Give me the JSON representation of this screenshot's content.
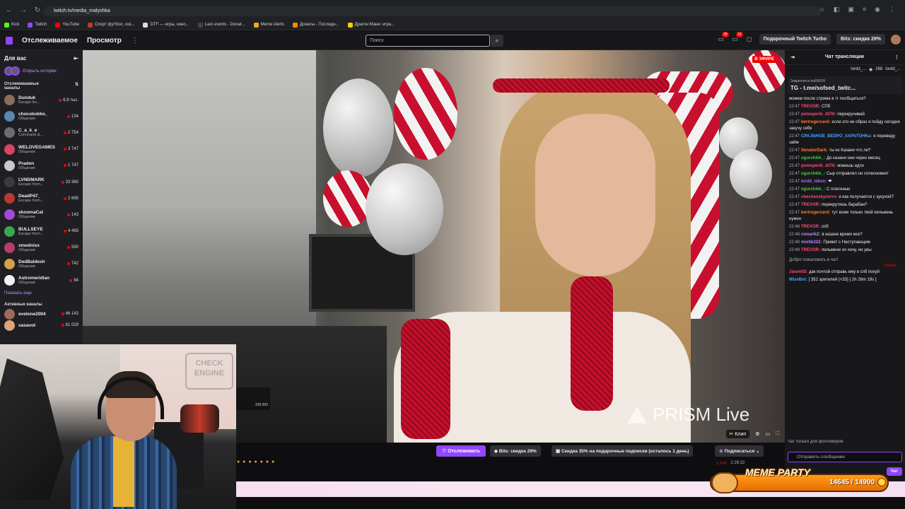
{
  "browser": {
    "url": "twitch.tv/media_malyshka",
    "bookmarks": [
      "Kick",
      "Twitch",
      "YouTube",
      "Спорт футбол, хок...",
      "DTF — игры, кино...",
      "Last events - Donat...",
      "Meme Alerts",
      "Донаты - Последн...",
      "Драгон Мани: игра..."
    ]
  },
  "header": {
    "nav_following": "Отслеживаемое",
    "nav_browse": "Просмотр",
    "search_placeholder": "Поиск",
    "notif_badge_1": "28",
    "notif_badge_2": "16",
    "turbo_label": "Подарочный Twitch Turbo",
    "bits_label": "Bits: скидка 29%"
  },
  "sidebar": {
    "title": "Для вас",
    "stories_label": "Открыть истории",
    "followed_title": "Отслеживаемые каналы",
    "channels": [
      {
        "name": "Dunduk",
        "category": "Escape fro...",
        "viewers": "6,9 тыс.",
        "color": "#8a6d5a"
      },
      {
        "name": "chocokokko_",
        "category": "Общение",
        "viewers": "134",
        "color": "#5b86b1"
      },
      {
        "name": "C_a_k_e",
        "category": "Command &...",
        "viewers": "2 754",
        "color": "#6c6c74"
      },
      {
        "name": "WELOVEGAMES",
        "category": "Общение",
        "viewers": "3 747",
        "color": "#d64561"
      },
      {
        "name": "Praden",
        "category": "Общение",
        "viewers": "1 747",
        "color": "#c9c9c9"
      },
      {
        "name": "LVNDMARK",
        "category": "Escape from...",
        "viewers": "33 360",
        "color": "#3b3b3b"
      },
      {
        "name": "DeadP47_",
        "category": "Escape from...",
        "viewers": "2 895",
        "color": "#b8392e"
      },
      {
        "name": "skoomaCat",
        "category": "Общение",
        "viewers": "143",
        "color": "#a04bd6"
      },
      {
        "name": "BULLSEYE",
        "category": "Escape from...",
        "viewers": "4 493",
        "color": "#3aa84c"
      },
      {
        "name": "xmednisx",
        "category": "Общение",
        "viewers": "590",
        "color": "#b33f66"
      },
      {
        "name": "DedBaldesh",
        "category": "Общение",
        "viewers": "742",
        "color": "#d6a04b"
      },
      {
        "name": "Astromeridian",
        "category": "Общение",
        "viewers": "94",
        "color": "#f2f2f2"
      }
    ],
    "show_more": "Показать еще",
    "active_title": "Активные каналы",
    "active_channels": [
      {
        "name": "evelone2004",
        "viewers": "46 143",
        "color": "#9d6b5a"
      },
      {
        "name": "sasavot",
        "viewers": "81 029",
        "color": "#e0a27b"
      }
    ]
  },
  "player": {
    "live_badge": "В ЭФИРЕ",
    "watermark": "PRISM Live",
    "clip_label": "Клип",
    "small_overlay": "339 000"
  },
  "info_bar": {
    "follow_label": "Отслеживать",
    "bits_label": "Bits: скидка 29%",
    "subs_discount_label": "Скидка 35% на подарочные подписки (осталось 1 день)",
    "subscribe_label": "Подписаться",
    "viewers": "344",
    "uptime": "2:26:32",
    "emotes": "● ● ● ● ● ● ●"
  },
  "chat": {
    "title": "Чат трансляции",
    "top_users": [
      "lordd_...",
      "268",
      "lordd_..."
    ],
    "pinned_label": "Закреплено",
    "pinned_by": "twi99024",
    "pinned_text": "TG - t.me/sofsed_twitc...",
    "messages": [
      {
        "ts": "",
        "user": "",
        "color": "#efeff1",
        "text": "можем после стрима в тг пообщаться?"
      },
      {
        "ts": "22:47",
        "user": "TREVOR:",
        "color": "#ff4a78",
        "text": "СПб"
      },
      {
        "ts": "22:47",
        "user": "pomoperik_4376:",
        "color": "#ff4a78",
        "text": "перекручивай"
      },
      {
        "ts": "22:47",
        "user": "bertrugercard:",
        "color": "#ff7f2a",
        "text": "если это не образ я пойду сегодня закучу себя"
      },
      {
        "ts": "22:47",
        "user": "CPAJIbHOE_BEDPO_XAPbTOHKa:",
        "color": "#4aa3ff",
        "text": "я переведу займ"
      },
      {
        "ts": "22:47",
        "user": "SenatorDark:",
        "color": "#ff7f2a",
        "text": "ты из Казани что ли?"
      },
      {
        "ts": "22:47",
        "user": "ogurchikk_:",
        "color": "#4ac84a",
        "text": "До казани они через месяц"
      },
      {
        "ts": "22:47",
        "user": "pomoperik_4376:",
        "color": "#ff4a78",
        "text": "можешь идти"
      },
      {
        "ts": "22:47",
        "user": "ogurchikk_:",
        "color": "#4ac84a",
        "text": "Сыр отправлял он сплесневеет"
      },
      {
        "ts": "22:47",
        "user": "lordd_nikon:",
        "color": "#a970ff",
        "text": "❤"
      },
      {
        "ts": "22:47",
        "user": "ogurchikk_:",
        "color": "#4ac84a",
        "text": "С плесенью"
      },
      {
        "ts": "22:47",
        "user": "chechenskyzorro:",
        "color": "#ff4a78",
        "text": "и как получается с кукухой?"
      },
      {
        "ts": "22:47",
        "user": "TREVOR:",
        "color": "#ff4a78",
        "text": "перекрутишь барабан?"
      },
      {
        "ts": "22:47",
        "user": "bertrugercard:",
        "color": "#ff7f2a",
        "text": "тут всем только твой пельмень нужен"
      },
      {
        "ts": "22:48",
        "user": "TREVOR:",
        "color": "#ff4a78",
        "text": "спб"
      },
      {
        "ts": "22:48",
        "user": "romarik2:",
        "color": "#b98aff",
        "text": "в казани время мск?"
      },
      {
        "ts": "22:48",
        "user": "mixtik322:",
        "color": "#b98aff",
        "text": "Привет с Наступающим"
      },
      {
        "ts": "22:48",
        "user": "TREVOR:",
        "color": "#ff4a78",
        "text": "пельмени оч хочу, но увы"
      }
    ],
    "welcome": "Добро пожаловать в чат!",
    "new_label": "Новое",
    "after_messages": [
      {
        "ts": "",
        "user": "Jason03:",
        "color": "#ff4a78",
        "text": "дак почтой отправь ему в спб похуй"
      },
      {
        "ts": "",
        "user": "WizeBot:",
        "color": "#4aa3ff",
        "text": "[ 352 зрителей (+33) ] 2h 26m 19s ]"
      }
    ],
    "followers_only": "Чат только для фолловеров",
    "input_placeholder": "Отправить сообщение",
    "send_label": "Чат"
  },
  "webcam": {
    "wall_logo": "CHECK ENGINE"
  },
  "meme_party": {
    "title": "MEME PARTY",
    "count": "14645 / 14900"
  }
}
